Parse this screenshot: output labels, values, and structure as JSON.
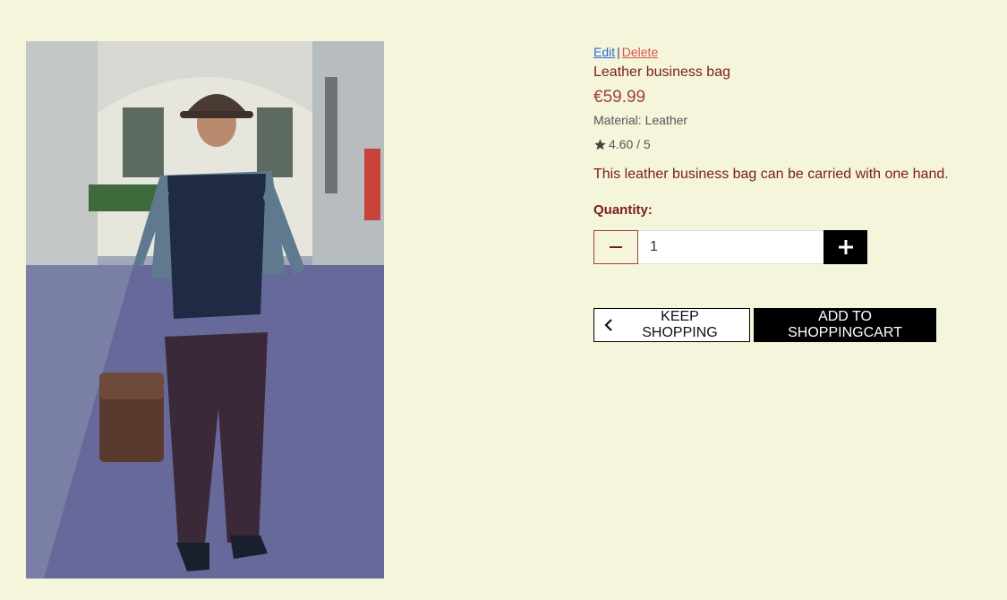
{
  "product": {
    "edit_label": "Edit",
    "separator": "|",
    "delete_label": "Delete",
    "name": "Leather business bag",
    "price": "€59.99",
    "material": "Material: Leather",
    "rating": "4.60 / 5",
    "description": "This leather business bag can be carried with one hand."
  },
  "quantity": {
    "label": "Quantity:",
    "value": "1"
  },
  "buttons": {
    "keep_shopping": "KEEP SHOPPING",
    "add_to_cart": "ADD TO SHOPPINGCART"
  },
  "icons": {
    "minus": "minus-icon",
    "plus": "plus-icon",
    "star": "star-icon",
    "chevron": "chevron-left-icon"
  }
}
